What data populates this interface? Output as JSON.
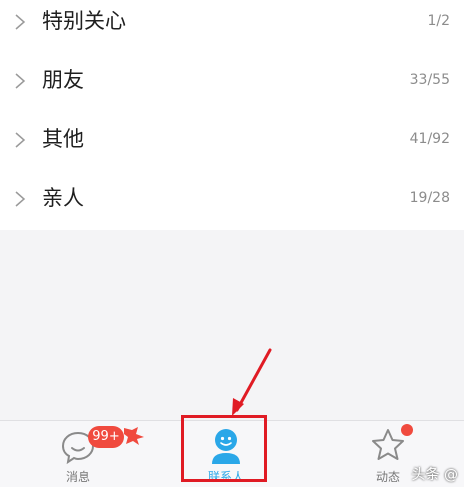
{
  "groups": [
    {
      "name": "特别关心",
      "count": "1/2"
    },
    {
      "name": "朋友",
      "count": "33/55"
    },
    {
      "name": "其他",
      "count": "41/92"
    },
    {
      "name": "亲人",
      "count": "19/28"
    }
  ],
  "tabs": {
    "messages": {
      "label": "消息",
      "badge": "99+",
      "icon": "chat-bubble-icon"
    },
    "contacts": {
      "label": "联系人",
      "icon": "contact-person-icon"
    },
    "feeds": {
      "label": "动态",
      "icon": "star-icon"
    }
  },
  "watermark": "头条 @",
  "colors": {
    "accent": "#2aa7e8",
    "badge": "#f04a3e",
    "annotation": "#e01b24"
  }
}
